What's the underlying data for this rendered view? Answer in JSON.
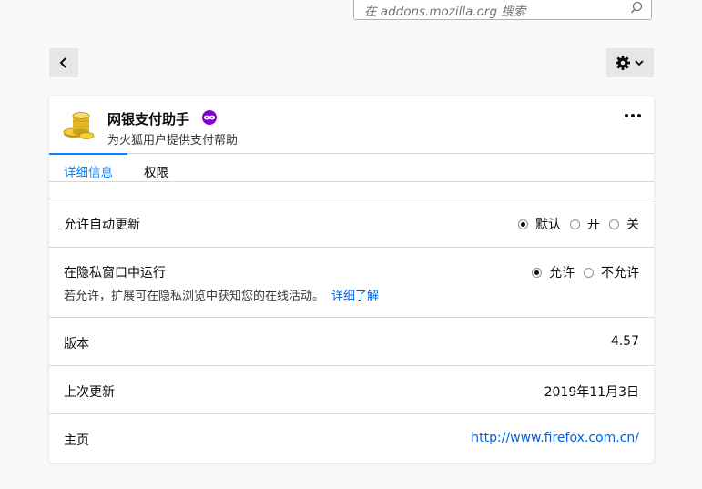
{
  "search": {
    "placeholder": "在 addons.mozilla.org 搜索"
  },
  "addon": {
    "name": "网银支付助手",
    "description": "为火狐用户提供支付帮助",
    "icon": "coins-icon",
    "badge_icon": "private-browsing-icon"
  },
  "tabs": [
    {
      "label": "详细信息",
      "active": true
    },
    {
      "label": "权限",
      "active": false
    }
  ],
  "auto_update": {
    "label": "允许自动更新",
    "options": [
      {
        "label": "默认",
        "checked": true
      },
      {
        "label": "开",
        "checked": false
      },
      {
        "label": "关",
        "checked": false
      }
    ]
  },
  "private": {
    "label": "在隐私窗口中运行",
    "options": [
      {
        "label": "允许",
        "checked": true
      },
      {
        "label": "不允许",
        "checked": false
      }
    ],
    "hint": "若允许，扩展可在隐私浏览中获知您的在线活动。",
    "learn_more": "详细了解"
  },
  "version": {
    "label": "版本",
    "value": "4.57"
  },
  "last_updated": {
    "label": "上次更新",
    "value": "2019年11月3日"
  },
  "homepage": {
    "label": "主页",
    "value": "http://www.firefox.com.cn/"
  },
  "colors": {
    "accent": "#0a84ff",
    "link": "#0060df",
    "badge": "#8000d7"
  }
}
